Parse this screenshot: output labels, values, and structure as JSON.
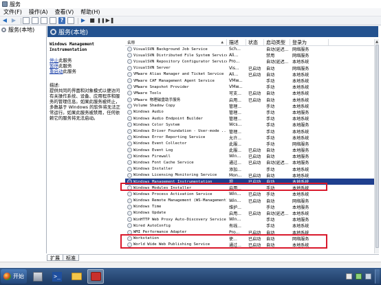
{
  "window": {
    "title": "服务"
  },
  "menu": {
    "items": [
      "文件(F)",
      "操作(A)",
      "查看(V)",
      "帮助(H)"
    ]
  },
  "toolbar": {
    "help": "?"
  },
  "tree": {
    "root": "服务(本地)"
  },
  "panel": {
    "title": "服务(本地)"
  },
  "details": {
    "service_title": "Windows Management Instrumentation",
    "stop_link": "停止",
    "stop_suffix": "此服务",
    "pause_link": "暂停",
    "pause_suffix": "此服务",
    "restart_link": "重启动",
    "restart_suffix": "此服务",
    "description_label": "描述:",
    "description": "提供共同的界面和对象模式以便访问有关操作系统、设备、应用程序和服务的管理信息。如果此服务被终止，多数基于 Windows 的软件将无法正常运行。如果此服务被禁用，任何依赖它的服务将无法启动。"
  },
  "grid": {
    "columns": {
      "name": "名称",
      "desc": "描述",
      "status": "状态",
      "start": "启动类型",
      "logon": "登录为"
    },
    "rows": [
      {
        "name": "VisualSVN Background Job Service",
        "desc": "Sch...",
        "status": "",
        "start": "自动(延迟...",
        "logon": "网络服务"
      },
      {
        "name": "VisualSVN Distributed File System Service",
        "desc": "Ali...",
        "status": "",
        "start": "禁用",
        "logon": "网络服务"
      },
      {
        "name": "VisualSVN Repository Configurator Service",
        "desc": "Pro...",
        "status": "",
        "start": "自动(延迟...",
        "logon": "本地系统"
      },
      {
        "name": "VisualSVN Server",
        "desc": "Vis...",
        "status": "已启动",
        "start": "自动",
        "logon": "网络服务"
      },
      {
        "name": "VMware Alias Manager and Ticket Service",
        "desc": "Ali...",
        "status": "已启动",
        "start": "自动",
        "logon": "本地系统"
      },
      {
        "name": "VMware CAF Management Agent Service",
        "desc": "VMw...",
        "status": "",
        "start": "手动",
        "logon": "本地系统"
      },
      {
        "name": "VMware Snapshot Provider",
        "desc": "VMw...",
        "status": "",
        "start": "手动",
        "logon": "本地系统"
      },
      {
        "name": "VMware Tools",
        "desc": "可支...",
        "status": "已启动",
        "start": "自动",
        "logon": "本地系统"
      },
      {
        "name": "VMware 物理磁盘助手服务",
        "desc": "启用...",
        "status": "已启动",
        "start": "自动",
        "logon": "本地系统"
      },
      {
        "name": "Volume Shadow Copy",
        "desc": "管理...",
        "status": "",
        "start": "手动",
        "logon": "本地系统"
      },
      {
        "name": "Windows Audio",
        "desc": "管理...",
        "status": "",
        "start": "手动",
        "logon": "本地服务"
      },
      {
        "name": "Windows Audio Endpoint Builder",
        "desc": "管理...",
        "status": "",
        "start": "手动",
        "logon": "本地系统"
      },
      {
        "name": "Windows Color System",
        "desc": "Wcs...",
        "status": "",
        "start": "手动",
        "logon": "本地服务"
      },
      {
        "name": "Windows Driver Foundation - User-mode ...",
        "desc": "管理...",
        "status": "",
        "start": "手动",
        "logon": "本地系统"
      },
      {
        "name": "Windows Error Reporting Service",
        "desc": "允许...",
        "status": "",
        "start": "手动",
        "logon": "本地系统"
      },
      {
        "name": "Windows Event Collector",
        "desc": "此服...",
        "status": "",
        "start": "手动",
        "logon": "网络服务"
      },
      {
        "name": "Windows Event Log",
        "desc": "此服...",
        "status": "已启动",
        "start": "自动",
        "logon": "本地服务"
      },
      {
        "name": "Windows Firewall",
        "desc": "Win...",
        "status": "已启动",
        "start": "自动",
        "logon": "本地服务"
      },
      {
        "name": "Windows Font Cache Service",
        "desc": "通过...",
        "status": "已启动",
        "start": "自动(延迟...",
        "logon": "本地服务"
      },
      {
        "name": "Windows Installer",
        "desc": "添加...",
        "status": "",
        "start": "手动",
        "logon": "本地系统"
      },
      {
        "name": "Windows Licensing Monitoring Service",
        "desc": "Mon...",
        "status": "已启动",
        "start": "自动",
        "logon": "本地系统"
      },
      {
        "name": "Windows Management Instrumentation",
        "desc": "提...",
        "status": "已启动",
        "start": "自动",
        "logon": "本地系统",
        "selected": true
      },
      {
        "name": "Windows Modules Installer",
        "desc": "启用...",
        "status": "",
        "start": "手动",
        "logon": "本地系统"
      },
      {
        "name": "Windows Process Activation Service",
        "desc": "Win...",
        "status": "已启动",
        "start": "手动",
        "logon": "本地系统"
      },
      {
        "name": "Windows Remote Management (WS-Management)",
        "desc": "Win...",
        "status": "已启动",
        "start": "自动",
        "logon": "网络服务"
      },
      {
        "name": "Windows Time",
        "desc": "维护...",
        "status": "",
        "start": "手动",
        "logon": "本地服务"
      },
      {
        "name": "Windows Update",
        "desc": "启用...",
        "status": "已启动",
        "start": "自动(延迟...",
        "logon": "本地系统"
      },
      {
        "name": "WinHTTP Web Proxy Auto-Discovery Service",
        "desc": "Win...",
        "status": "",
        "start": "手动",
        "logon": "本地服务"
      },
      {
        "name": "Wired AutoConfig",
        "desc": "有线...",
        "status": "",
        "start": "手动",
        "logon": "本地系统"
      },
      {
        "name": "WMI Performance Adapter",
        "desc": "Pro...",
        "status": "已启动",
        "start": "自动",
        "logon": "本地系统"
      },
      {
        "name": "Workstation",
        "desc": "使...",
        "status": "已启动",
        "start": "自动",
        "logon": "网络服务"
      },
      {
        "name": "World Wide Web Publishing Service",
        "desc": "通过...",
        "status": "已启动",
        "start": "自动",
        "logon": "本地系统"
      }
    ]
  },
  "tabs": [
    "扩展",
    "标准"
  ],
  "taskbar": {
    "start_label": "开始"
  },
  "colors": {
    "header": "#24528f",
    "selection": "#1f3f8e",
    "highlight": "#d9182b"
  }
}
